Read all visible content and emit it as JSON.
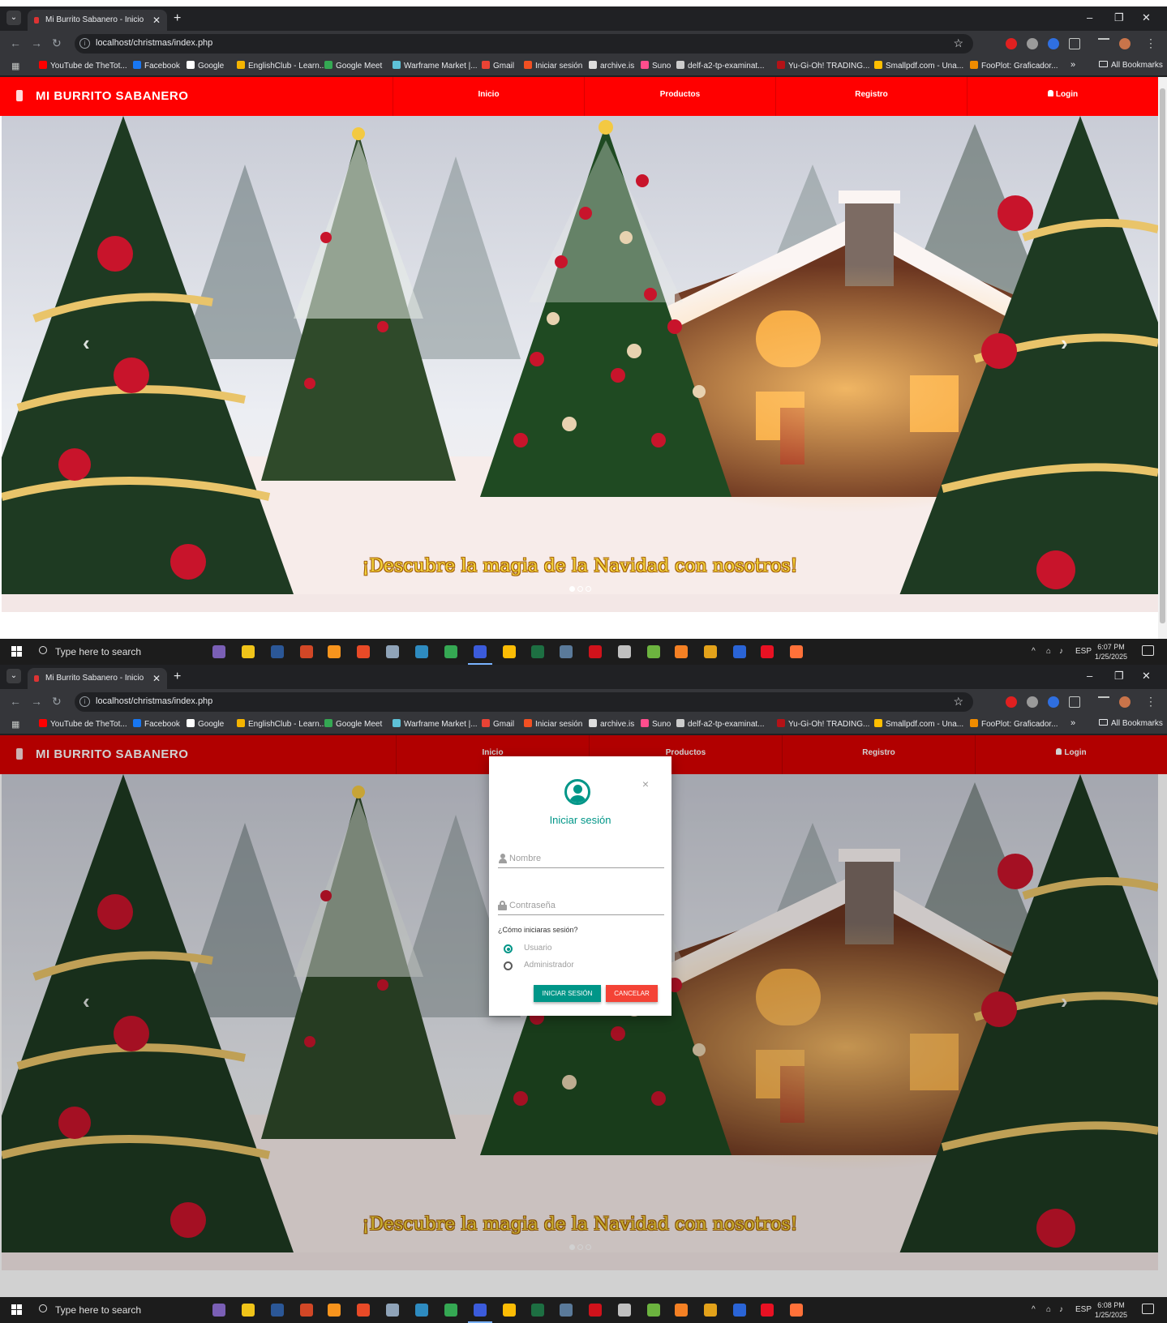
{
  "browser": {
    "tab_title": "Mi Burrito Sabanero - Inicio",
    "url": "localhost/christmas/index.php",
    "bookmarks": [
      {
        "label": "YouTube de TheTot...",
        "color": "#ff0000"
      },
      {
        "label": "Facebook",
        "color": "#1877f2"
      },
      {
        "label": "Google",
        "color": "#ffffff"
      },
      {
        "label": "EnglishClub - Learn...",
        "color": "#f4b400"
      },
      {
        "label": "Google Meet",
        "color": "#34a853"
      },
      {
        "label": "Warframe Market |...",
        "color": "#5ec2d8"
      },
      {
        "label": "Gmail",
        "color": "#ea4335"
      },
      {
        "label": "Iniciar sesión",
        "color": "#f25022"
      },
      {
        "label": "archive.is",
        "color": "#dddddd"
      },
      {
        "label": "Suno",
        "color": "#ff4d8d"
      },
      {
        "label": "delf-a2-tp-examinat...",
        "color": "#cccccc"
      },
      {
        "label": "Yu-Gi-Oh! TRADING...",
        "color": "#b31217"
      },
      {
        "label": "Smallpdf.com - Una...",
        "color": "#ffbf00"
      },
      {
        "label": "FooPlot: Graficador...",
        "color": "#f08c00"
      }
    ],
    "more_bookmarks": "»",
    "all_bookmarks": "All Bookmarks"
  },
  "site": {
    "brand": "MI BURRITO SABANERO",
    "nav": [
      {
        "label": "Inicio"
      },
      {
        "label": "Productos"
      },
      {
        "label": "Registro"
      },
      {
        "label": "Login"
      }
    ],
    "hero_caption": "¡Descubre la magia de la Navidad con nosotros!",
    "slide_count": 3,
    "active_slide": 1
  },
  "login_modal": {
    "title": "Iniciar sesión",
    "close": "×",
    "username_placeholder": "Nombre",
    "password_placeholder": "Contraseña",
    "question": "¿Cómo iniciaras sesión?",
    "options": [
      {
        "label": "Usuario",
        "selected": true
      },
      {
        "label": "Administrador",
        "selected": false
      }
    ],
    "login_button": "INICIAR SESIÓN",
    "cancel_button": "CANCELAR",
    "accent": "#009688",
    "cancel_color": "#f44336"
  },
  "taskbar": {
    "search_placeholder": "Type here to search",
    "language": "ESP",
    "shot_a": {
      "time": "6:07 PM",
      "date": "1/25/2025"
    },
    "shot_b": {
      "time": "6:08 PM",
      "date": "1/25/2025"
    }
  },
  "colors": {
    "navbar_shot_a": "#ff0000",
    "navbar_shot_b": "#d80000",
    "caption": "#f2d23a"
  }
}
